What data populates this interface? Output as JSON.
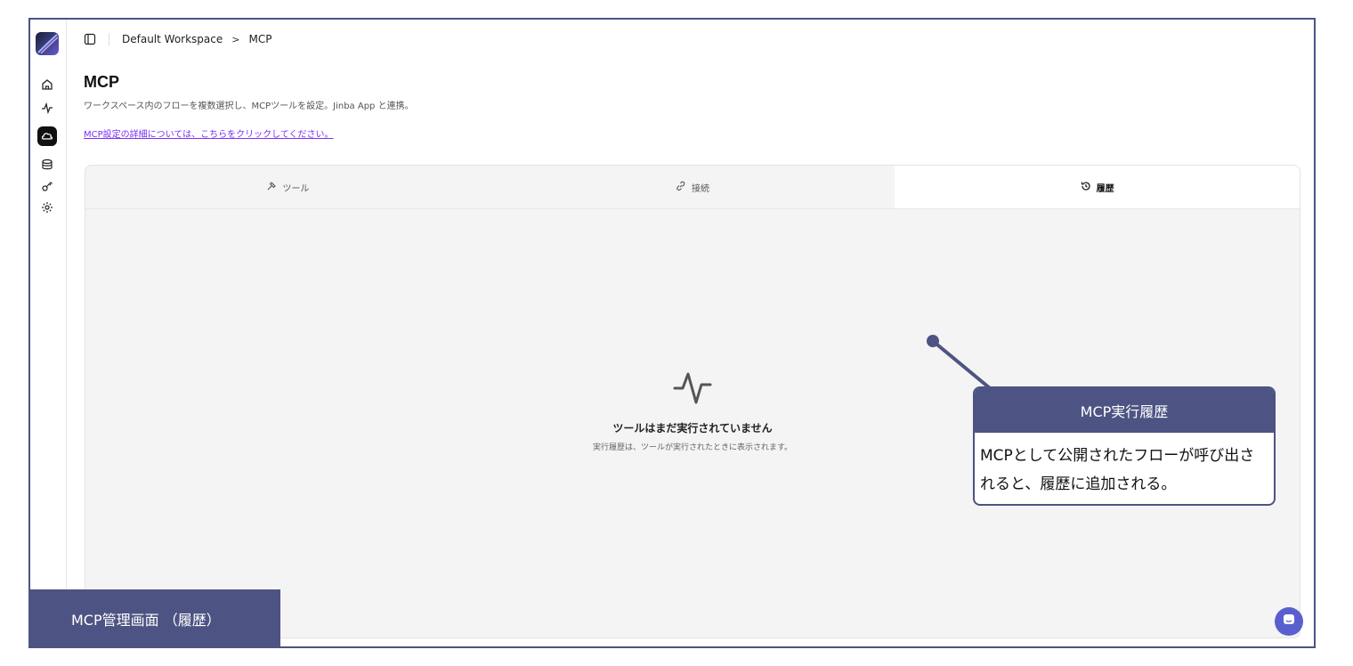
{
  "breadcrumb": {
    "workspace": "Default Workspace",
    "separator": ">",
    "current": "MCP"
  },
  "page": {
    "title": "MCP",
    "subtitle": "ワークスペース内のフローを複数選択し、MCPツールを設定。Jinba App と連携。",
    "doc_link": "MCP設定の詳細については、こちらをクリックしてください。"
  },
  "tabs": [
    {
      "label": "ツール",
      "icon": "hammer-icon",
      "active": false
    },
    {
      "label": "接続",
      "icon": "link-icon",
      "active": false
    },
    {
      "label": "履歴",
      "icon": "history-icon",
      "active": true
    }
  ],
  "empty_state": {
    "icon": "activity-icon",
    "title": "ツールはまだ実行されていません",
    "description": "実行履歴は、ツールが実行されたときに表示されます。"
  },
  "callout": {
    "title": "MCP実行履歴",
    "body": "MCPとして公開されたフローが呼び出されると、履歴に追加される。"
  },
  "caption": "MCP管理画面 （履歴）",
  "colors": {
    "accent": "#4d5382",
    "link": "#7b2ff7",
    "fab": "#5a5fcf"
  }
}
